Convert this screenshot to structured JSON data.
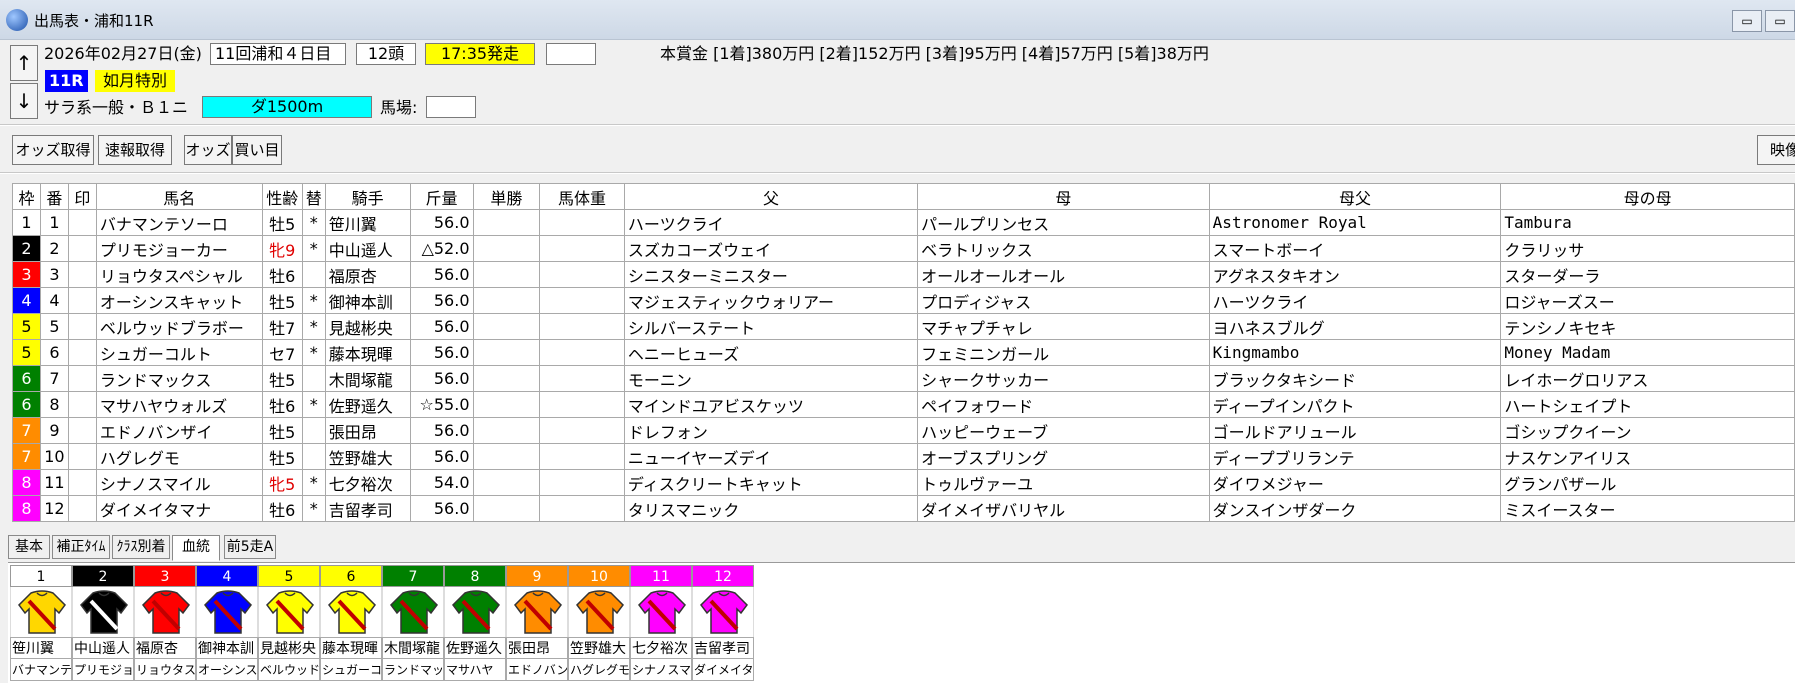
{
  "window": {
    "title": "出馬表・浦和11R",
    "minimize_label": "▭",
    "restore_label": "▭"
  },
  "nav": {
    "up_label": "↑",
    "down_label": "↓"
  },
  "race": {
    "date": "2026年02月27日(金)",
    "meeting": "11回浦和４日目",
    "head_count": "12頭",
    "post_time": "17:35発走",
    "extra_box": "",
    "race_no": "11R",
    "race_name": "如月特別",
    "race_class": "サラ系一般・Ｂ１ニ",
    "course": "ダ1500m",
    "track_label": "馬場:",
    "track_value": "",
    "prize": "本賞金 [1着]380万円 [2着]152万円 [3着]95万円 [4着]57万円 [5着]38万円"
  },
  "toolbar": {
    "odds_fetch": "オッズ取得",
    "combo_fetch": "速報取得",
    "odds": "オッズ",
    "buy": "買い目",
    "video": "映像"
  },
  "table": {
    "headers": [
      "枠",
      "番",
      "印",
      "馬名",
      "性齢",
      "替",
      "騎手",
      "斤量",
      "単勝",
      "馬体重",
      "父",
      "母",
      "母父",
      "母の母"
    ],
    "rows": [
      {
        "waku": "1",
        "ban": "1",
        "mark": "",
        "horse": "バナマンテソーロ",
        "sexage": "牡5",
        "kae": "*",
        "jockey": "笹川翼",
        "weight": "56.0",
        "win": "",
        "body": "",
        "sire": "ハーツクライ",
        "dam": "パールプリンセス",
        "damsire": "Astronomer Royal",
        "damdam": "Tambura"
      },
      {
        "waku": "2",
        "ban": "2",
        "mark": "",
        "horse": "プリモジョーカー",
        "sexage": "牝9",
        "kae": "*",
        "jockey": "中山遥人",
        "weight": "△52.0",
        "win": "",
        "body": "",
        "sire": "スズカコーズウェイ",
        "dam": "ベラトリックス",
        "damsire": "スマートボーイ",
        "damdam": "クラリッサ"
      },
      {
        "waku": "3",
        "ban": "3",
        "mark": "",
        "horse": "リョウタスペシャル",
        "sexage": "牡6",
        "kae": "",
        "jockey": "福原杏",
        "weight": "56.0",
        "win": "",
        "body": "",
        "sire": "シニスターミニスター",
        "dam": "オールオールオール",
        "damsire": "アグネスタキオン",
        "damdam": "スターダーラ"
      },
      {
        "waku": "4",
        "ban": "4",
        "mark": "",
        "horse": "オーシンスキャット",
        "sexage": "牡5",
        "kae": "*",
        "jockey": "御神本訓",
        "weight": "56.0",
        "win": "",
        "body": "",
        "sire": "マジェスティックウォリアー",
        "dam": "プロディジャス",
        "damsire": "ハーツクライ",
        "damdam": "ロジャーズスー"
      },
      {
        "waku": "5",
        "ban": "5",
        "mark": "",
        "horse": "ベルウッドブラボー",
        "sexage": "牡7",
        "kae": "*",
        "jockey": "見越彬央",
        "weight": "56.0",
        "win": "",
        "body": "",
        "sire": "シルバーステート",
        "dam": "マチャプチャレ",
        "damsire": "ヨハネスブルグ",
        "damdam": "テンシノキセキ"
      },
      {
        "waku": "5",
        "ban": "6",
        "mark": "",
        "horse": "シュガーコルト",
        "sexage": "セ7",
        "kae": "*",
        "jockey": "藤本現暉",
        "weight": "56.0",
        "win": "",
        "body": "",
        "sire": "ヘニーヒューズ",
        "dam": "フェミニンガール",
        "damsire": "Kingmambo",
        "damdam": "Money Madam"
      },
      {
        "waku": "6",
        "ban": "7",
        "mark": "",
        "horse": "ランドマックス",
        "sexage": "牡5",
        "kae": "",
        "jockey": "木間塚龍",
        "weight": "56.0",
        "win": "",
        "body": "",
        "sire": "モーニン",
        "dam": "シャークサッカー",
        "damsire": "ブラックタキシード",
        "damdam": "レイホーグロリアス"
      },
      {
        "waku": "6",
        "ban": "8",
        "mark": "",
        "horse": "マサハヤウォルズ",
        "sexage": "牡6",
        "kae": "*",
        "jockey": "佐野遥久",
        "weight": "☆55.0",
        "win": "",
        "body": "",
        "sire": "マインドユアビスケッツ",
        "dam": "ペイフォワード",
        "damsire": "ディープインパクト",
        "damdam": "ハートシェイプト"
      },
      {
        "waku": "7",
        "ban": "9",
        "mark": "",
        "horse": "エドノバンザイ",
        "sexage": "牡5",
        "kae": "",
        "jockey": "張田昂",
        "weight": "56.0",
        "win": "",
        "body": "",
        "sire": "ドレフォン",
        "dam": "ハッピーウェーブ",
        "damsire": "ゴールドアリュール",
        "damdam": "ゴシップクイーン"
      },
      {
        "waku": "7",
        "ban": "10",
        "mark": "",
        "horse": "ハグレグモ",
        "sexage": "牡5",
        "kae": "",
        "jockey": "笠野雄大",
        "weight": "56.0",
        "win": "",
        "body": "",
        "sire": "ニューイヤーズデイ",
        "dam": "オーブスプリング",
        "damsire": "ディープブリランテ",
        "damdam": "ナスケンアイリス"
      },
      {
        "waku": "8",
        "ban": "11",
        "mark": "",
        "horse": "シナノスマイル",
        "sexage": "牝5",
        "kae": "*",
        "jockey": "七夕裕次",
        "weight": "54.0",
        "win": "",
        "body": "",
        "sire": "ディスクリートキャット",
        "dam": "トゥルヴァーユ",
        "damsire": "ダイワメジャー",
        "damdam": "グランパザール"
      },
      {
        "waku": "8",
        "ban": "12",
        "mark": "",
        "horse": "ダイメイタマナ",
        "sexage": "牡6",
        "kae": "*",
        "jockey": "吉留孝司",
        "weight": "56.0",
        "win": "",
        "body": "",
        "sire": "タリスマニック",
        "dam": "ダイメイザバリヤル",
        "damsire": "ダンスインザダーク",
        "damdam": "ミスイースター"
      }
    ]
  },
  "waku_colors": {
    "1": {
      "bg": "#ffffff",
      "fg": "#000000"
    },
    "2": {
      "bg": "#000000",
      "fg": "#ffffff"
    },
    "3": {
      "bg": "#ff0000",
      "fg": "#ffffff"
    },
    "4": {
      "bg": "#0000ff",
      "fg": "#ffffff"
    },
    "5": {
      "bg": "#ffff00",
      "fg": "#000000"
    },
    "6": {
      "bg": "#008000",
      "fg": "#ffffff"
    },
    "7": {
      "bg": "#ff8c00",
      "fg": "#ffffff"
    },
    "8": {
      "bg": "#ff00ff",
      "fg": "#ffffff"
    }
  },
  "tabs": [
    "基本",
    "補正ﾀｲﾑ",
    "ｸﾗｽ別着",
    "血統",
    "前5走A"
  ],
  "active_tab": "血統",
  "jockeys_panel": [
    {
      "num": "1",
      "jockey": "笹川翼",
      "horse_short": "バナマンテ",
      "silk": "jersey-icon"
    },
    {
      "num": "2",
      "jockey": "中山遥人",
      "horse_short": "プリモジョ",
      "silk": "jersey-icon"
    },
    {
      "num": "3",
      "jockey": "福原杏",
      "horse_short": "リョウタス",
      "silk": "jersey-icon"
    },
    {
      "num": "4",
      "jockey": "御神本訓",
      "horse_short": "オーシンス",
      "silk": "jersey-icon"
    },
    {
      "num": "5",
      "jockey": "見越彬央",
      "horse_short": "ベルウッド",
      "silk": "jersey-icon"
    },
    {
      "num": "6",
      "jockey": "藤本現暉",
      "horse_short": "シュガーコ",
      "silk": "jersey-icon"
    },
    {
      "num": "7",
      "jockey": "木間塚龍",
      "horse_short": "ランドマッ",
      "silk": "jersey-icon"
    },
    {
      "num": "8",
      "jockey": "佐野遥久",
      "horse_short": "マサハヤ",
      "silk": "jersey-icon"
    },
    {
      "num": "9",
      "jockey": "張田昂",
      "horse_short": "エドノバン",
      "silk": "jersey-icon"
    },
    {
      "num": "10",
      "jockey": "笠野雄大",
      "horse_short": "ハグレグモ",
      "silk": "jersey-icon"
    },
    {
      "num": "11",
      "jockey": "七夕裕次",
      "horse_short": "シナノスマ",
      "silk": "jersey-icon"
    },
    {
      "num": "12",
      "jockey": "吉留孝司",
      "horse_short": "ダイメイタ",
      "silk": "jersey-icon"
    }
  ],
  "colors": {
    "post_time_bg": "#ffff00",
    "race_no_bg": "#0000ff",
    "race_name_bg": "#ffff00",
    "course_bg": "#00ffff",
    "female_text": "#e00000"
  }
}
